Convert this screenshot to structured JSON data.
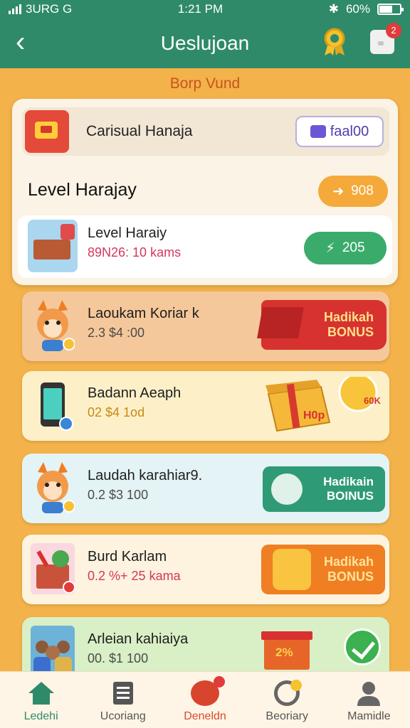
{
  "status_bar": {
    "carrier": "3URG G",
    "time": "1:21 PM",
    "battery": "60%"
  },
  "app_bar": {
    "title": "Ueslujoan",
    "back_icon": "chevron-left-icon",
    "notif_count": "2"
  },
  "banner": "Borp Vund",
  "hero": {
    "title": "Carisual Hanaja",
    "pill_label": "faal00"
  },
  "section": {
    "title": "Level Harajay",
    "badge": "908"
  },
  "level_row": {
    "name": "Level Haraiy",
    "detail": "89N26: 10 kams",
    "pill_label": "205"
  },
  "cards": [
    {
      "name": "Laoukam Koriar k",
      "detail": "2.3 $4 :00",
      "action_line1": "Hadikah",
      "action_line2": "BONUS"
    },
    {
      "name": "Badann Aeaph",
      "detail": "02 $4 1od",
      "action_text": "H0p",
      "burst_text": "60K"
    },
    {
      "name": "Laudah karahiar9.",
      "detail": "0.2 $3 100",
      "action_line1": "Hadikain",
      "action_line2": "BOINUS"
    },
    {
      "name": "Burd Karlam",
      "detail": "0.2 %+ 25 kama",
      "action_line1": "Hadikah",
      "action_line2": "BONUS"
    },
    {
      "name": "Arleian kahiaiya",
      "detail": "00. $1 100",
      "action_text": "2%"
    }
  ],
  "nav": [
    {
      "label": "Ledehi"
    },
    {
      "label": "Ucoriang"
    },
    {
      "label": "Deneldn"
    },
    {
      "label": "Beoriary"
    },
    {
      "label": "Mamidle"
    }
  ],
  "colors": {
    "primary": "#2f8a69",
    "background": "#f3b24a",
    "accent_red": "#d7322f",
    "accent_orange": "#f07e22"
  }
}
